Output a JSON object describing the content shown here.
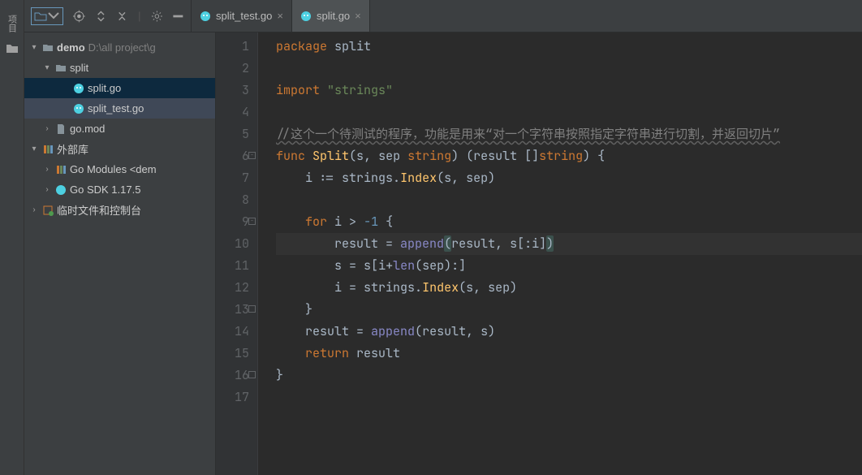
{
  "leftGutter": {
    "label": "项目"
  },
  "tabs": [
    {
      "label": "split_test.go",
      "active": false
    },
    {
      "label": "split.go",
      "active": true
    }
  ],
  "tree": {
    "root": {
      "name": "demo",
      "path": "D:\\all project\\g"
    },
    "splitFolder": "split",
    "files": {
      "splitGo": "split.go",
      "splitTestGo": "split_test.go",
      "goMod": "go.mod"
    },
    "extLib": "外部库",
    "goModules": "Go Modules <dem",
    "goSdk": "Go SDK 1.17.5",
    "scratch": "临时文件和控制台"
  },
  "code": {
    "lines": [
      {
        "n": 1,
        "segs": [
          {
            "t": "package ",
            "c": "kw"
          },
          {
            "t": "split",
            "c": "id"
          }
        ]
      },
      {
        "n": 2,
        "segs": []
      },
      {
        "n": 3,
        "segs": [
          {
            "t": "import ",
            "c": "kw"
          },
          {
            "t": "\"strings\"",
            "c": "str"
          }
        ]
      },
      {
        "n": 4,
        "segs": []
      },
      {
        "n": 5,
        "segs": [
          {
            "t": "//这个一个待测试的程序，功能是用来“对一个字符串按照指定字符串进行切割，并返回切片”",
            "c": "cmt"
          }
        ]
      },
      {
        "n": 6,
        "fold": "-",
        "segs": [
          {
            "t": "func ",
            "c": "kw"
          },
          {
            "t": "Split",
            "c": "fn"
          },
          {
            "t": "(",
            "c": "pn"
          },
          {
            "t": "s",
            "c": "id"
          },
          {
            "t": ", ",
            "c": "op"
          },
          {
            "t": "sep ",
            "c": "id"
          },
          {
            "t": "string",
            "c": "kw"
          },
          {
            "t": ") (",
            "c": "pn"
          },
          {
            "t": "result ",
            "c": "id"
          },
          {
            "t": "[]",
            "c": "pn"
          },
          {
            "t": "string",
            "c": "kw"
          },
          {
            "t": ") {",
            "c": "pn"
          }
        ]
      },
      {
        "n": 7,
        "segs": [
          {
            "t": "    i ",
            "c": "id"
          },
          {
            "t": ":= ",
            "c": "op"
          },
          {
            "t": "strings",
            "c": "id"
          },
          {
            "t": ".",
            "c": "op"
          },
          {
            "t": "Index",
            "c": "fn"
          },
          {
            "t": "(",
            "c": "pn"
          },
          {
            "t": "s",
            "c": "id"
          },
          {
            "t": ", ",
            "c": "op"
          },
          {
            "t": "sep",
            "c": "id"
          },
          {
            "t": ")",
            "c": "pn"
          }
        ]
      },
      {
        "n": 8,
        "segs": []
      },
      {
        "n": 9,
        "fold": "-",
        "segs": [
          {
            "t": "    ",
            "c": "id"
          },
          {
            "t": "for ",
            "c": "kw"
          },
          {
            "t": "i ",
            "c": "id"
          },
          {
            "t": "> ",
            "c": "op"
          },
          {
            "t": "-1 ",
            "c": "num"
          },
          {
            "t": "{",
            "c": "pn"
          }
        ]
      },
      {
        "n": 10,
        "cur": true,
        "segs": [
          {
            "t": "        result ",
            "c": "id"
          },
          {
            "t": "= ",
            "c": "op"
          },
          {
            "t": "append",
            "c": "builtin"
          },
          {
            "t": "(",
            "c": "pn hlp"
          },
          {
            "t": "result",
            "c": "id"
          },
          {
            "t": ", ",
            "c": "op"
          },
          {
            "t": "s",
            "c": "id"
          },
          {
            "t": "[:",
            "c": "op"
          },
          {
            "t": "i",
            "c": "id"
          },
          {
            "t": "]",
            "c": "op"
          },
          {
            "t": ")",
            "c": "pn hlp"
          }
        ]
      },
      {
        "n": 11,
        "segs": [
          {
            "t": "        s ",
            "c": "id"
          },
          {
            "t": "= ",
            "c": "op"
          },
          {
            "t": "s",
            "c": "id"
          },
          {
            "t": "[",
            "c": "op"
          },
          {
            "t": "i",
            "c": "id"
          },
          {
            "t": "+",
            "c": "op"
          },
          {
            "t": "len",
            "c": "builtin"
          },
          {
            "t": "(",
            "c": "pn"
          },
          {
            "t": "sep",
            "c": "id"
          },
          {
            "t": "):]",
            "c": "op"
          }
        ]
      },
      {
        "n": 12,
        "segs": [
          {
            "t": "        i ",
            "c": "id"
          },
          {
            "t": "= ",
            "c": "op"
          },
          {
            "t": "strings",
            "c": "id"
          },
          {
            "t": ".",
            "c": "op"
          },
          {
            "t": "Index",
            "c": "fn"
          },
          {
            "t": "(",
            "c": "pn"
          },
          {
            "t": "s",
            "c": "id"
          },
          {
            "t": ", ",
            "c": "op"
          },
          {
            "t": "sep",
            "c": "id"
          },
          {
            "t": ")",
            "c": "pn"
          }
        ]
      },
      {
        "n": 13,
        "fold": "^",
        "segs": [
          {
            "t": "    }",
            "c": "pn"
          }
        ]
      },
      {
        "n": 14,
        "segs": [
          {
            "t": "    result ",
            "c": "id"
          },
          {
            "t": "= ",
            "c": "op"
          },
          {
            "t": "append",
            "c": "builtin"
          },
          {
            "t": "(",
            "c": "pn"
          },
          {
            "t": "result",
            "c": "id"
          },
          {
            "t": ", ",
            "c": "op"
          },
          {
            "t": "s",
            "c": "id"
          },
          {
            "t": ")",
            "c": "pn"
          }
        ]
      },
      {
        "n": 15,
        "segs": [
          {
            "t": "    ",
            "c": "id"
          },
          {
            "t": "return ",
            "c": "kw"
          },
          {
            "t": "result",
            "c": "id"
          }
        ]
      },
      {
        "n": 16,
        "fold": "^",
        "segs": [
          {
            "t": "}",
            "c": "pn"
          }
        ]
      },
      {
        "n": 17,
        "segs": []
      }
    ]
  }
}
